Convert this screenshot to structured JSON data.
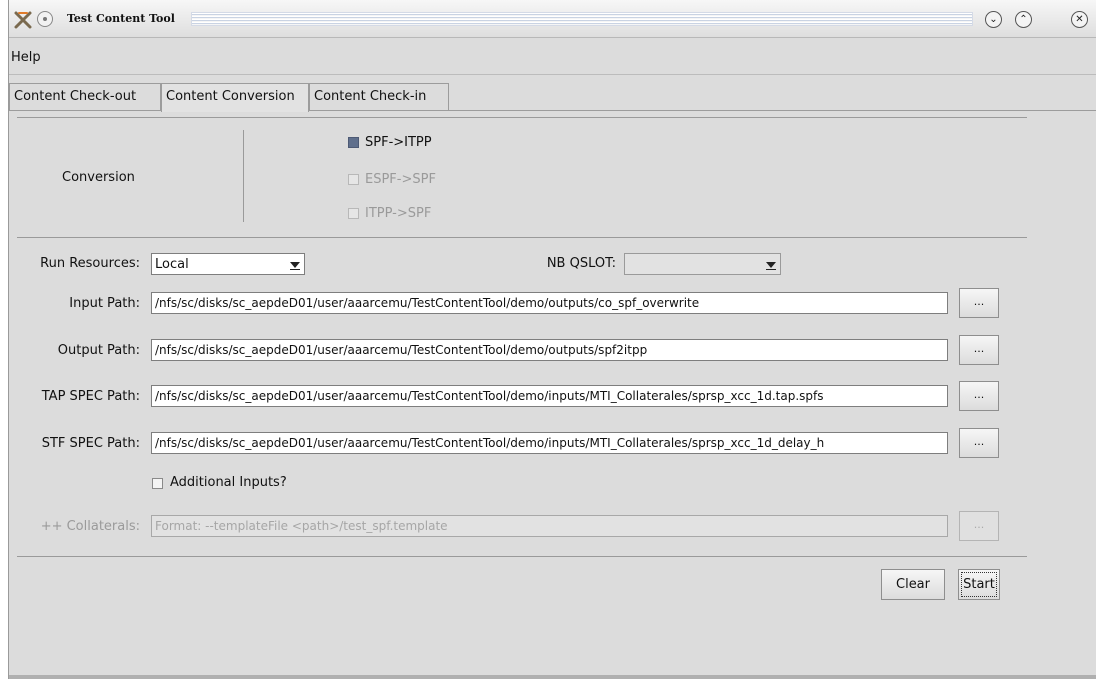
{
  "window": {
    "title": "Test Content Tool",
    "controls": {
      "minimize_icon": "⌄",
      "maximize_icon": "⌃",
      "close_icon": "✕"
    }
  },
  "menu": {
    "help": "Help"
  },
  "tabs": [
    {
      "label": "Content Check-out",
      "active": false
    },
    {
      "label": "Content Conversion",
      "active": true
    },
    {
      "label": "Content Check-in",
      "active": false
    }
  ],
  "conversion": {
    "label": "Conversion",
    "options": [
      {
        "label": "SPF->ITPP",
        "checked": true,
        "enabled": true
      },
      {
        "label": "ESPF->SPF",
        "checked": false,
        "enabled": false
      },
      {
        "label": "ITPP->SPF",
        "checked": false,
        "enabled": false
      }
    ]
  },
  "run_resources": {
    "label": "Run Resources:",
    "value": "Local"
  },
  "nb_qslot": {
    "label": "NB QSLOT:",
    "value": ""
  },
  "paths": {
    "input": {
      "label": "Input Path:",
      "value": "/nfs/sc/disks/sc_aepdeD01/user/aaarcemu/TestContentTool/demo/outputs/co_spf_overwrite"
    },
    "output": {
      "label": "Output Path:",
      "value": "/nfs/sc/disks/sc_aepdeD01/user/aaarcemu/TestContentTool/demo/outputs/spf2itpp"
    },
    "tap_spec": {
      "label": "TAP SPEC Path:",
      "value": "/nfs/sc/disks/sc_aepdeD01/user/aaarcemu/TestContentTool/demo/inputs/MTI_Collaterales/sprsp_xcc_1d.tap.spfs"
    },
    "stf_spec": {
      "label": "STF SPEC Path:",
      "value": "/nfs/sc/disks/sc_aepdeD01/user/aaarcemu/TestContentTool/demo/inputs/MTI_Collaterales/sprsp_xcc_1d_delay_h"
    }
  },
  "browse_label": "...",
  "additional_inputs": {
    "label": "Additional Inputs?",
    "checked": false
  },
  "collaterals": {
    "label": "++ Collaterals:",
    "placeholder": "Format: --templateFile <path>/test_spf.template"
  },
  "actions": {
    "clear": "Clear",
    "start": "Start"
  },
  "colors": {
    "window_bg": "#dcdcdc",
    "checked_box": "#5f6f8c",
    "disabled_text": "#9a9a9a"
  }
}
